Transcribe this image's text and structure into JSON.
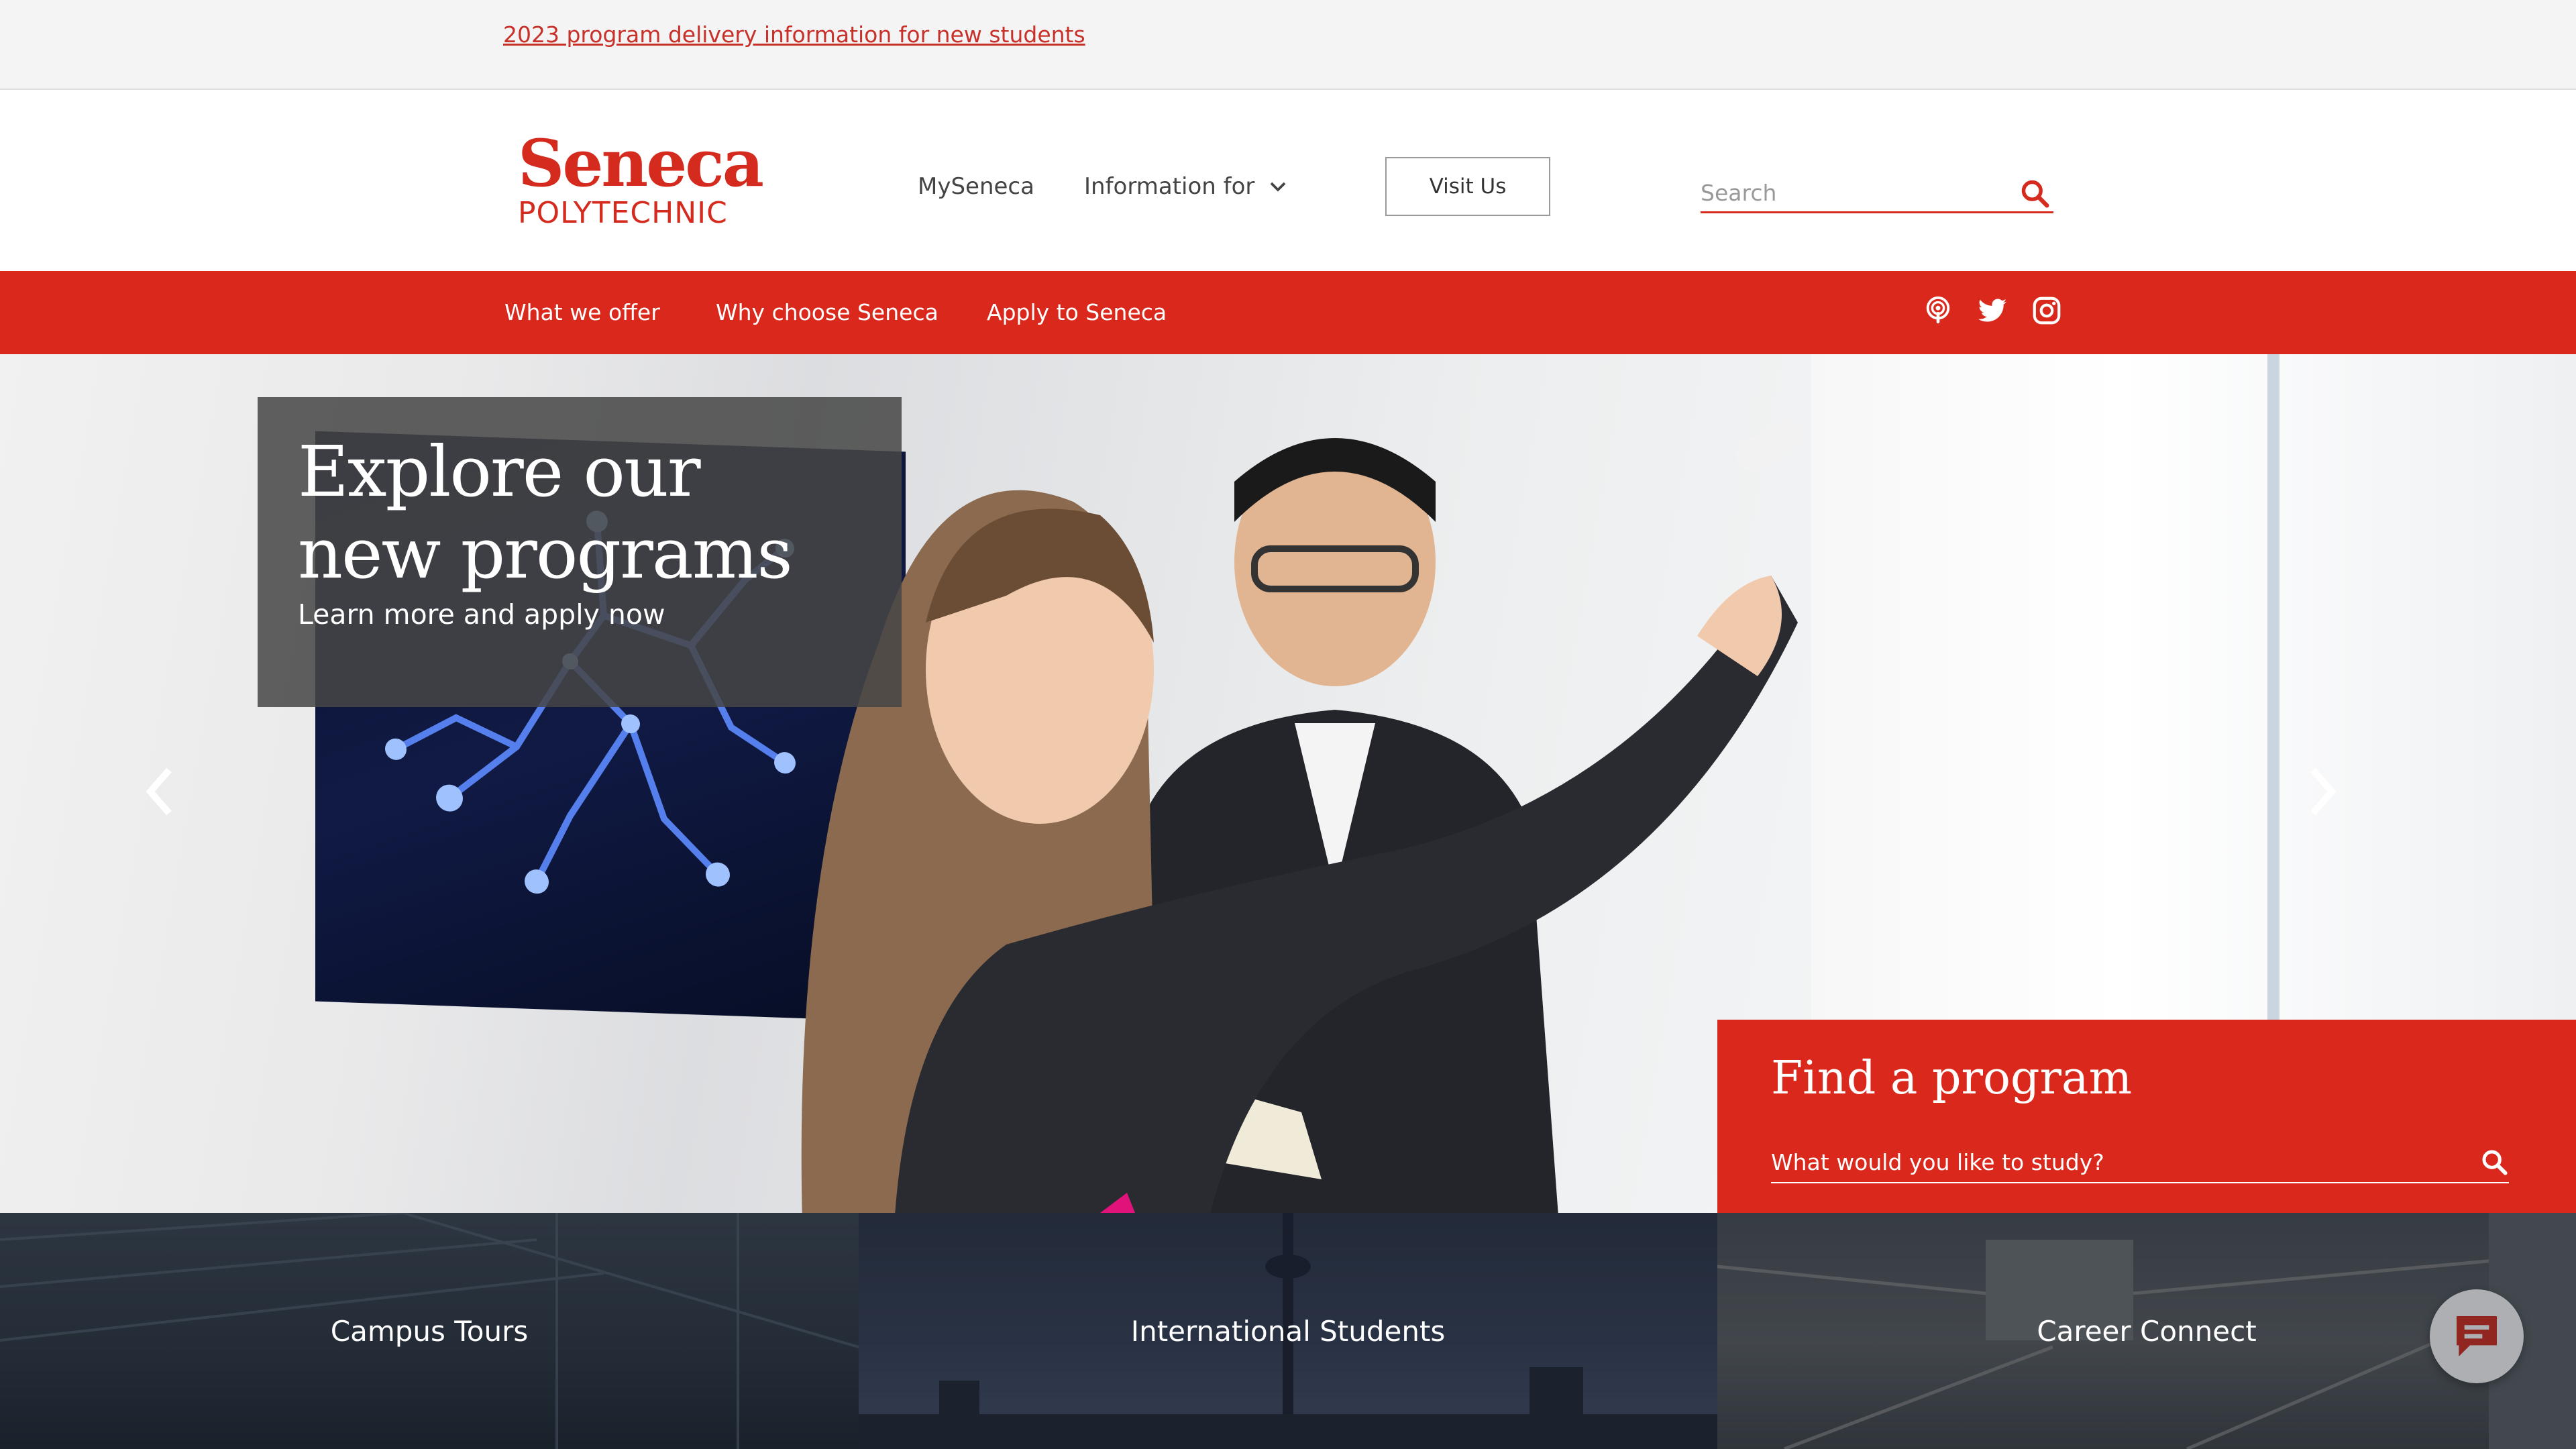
{
  "announcement": {
    "link_text": "2023 program delivery information for new students"
  },
  "header": {
    "logo": {
      "word": "Seneca",
      "sub": "POLYTECHNIC"
    },
    "nav": {
      "mysen": "MySeneca",
      "info": "Information for"
    },
    "visit_label": "Visit Us",
    "search_placeholder": "Search"
  },
  "rednav": {
    "items": [
      "What we offer",
      "Why choose Seneca",
      "Apply to Seneca"
    ],
    "social_icons": [
      "podcast-icon",
      "twitter-icon",
      "instagram-icon"
    ]
  },
  "hero": {
    "title": "Explore our new programs",
    "subtitle": "Learn more and apply now"
  },
  "find_program": {
    "title": "Find a program",
    "placeholder": "What would you like to study?"
  },
  "tiles": [
    "Campus Tours",
    "International Students",
    "Career Connect"
  ],
  "colors": {
    "brand_red": "#da291c",
    "logo_red": "#d52b1e",
    "link_red": "#c8302a"
  }
}
